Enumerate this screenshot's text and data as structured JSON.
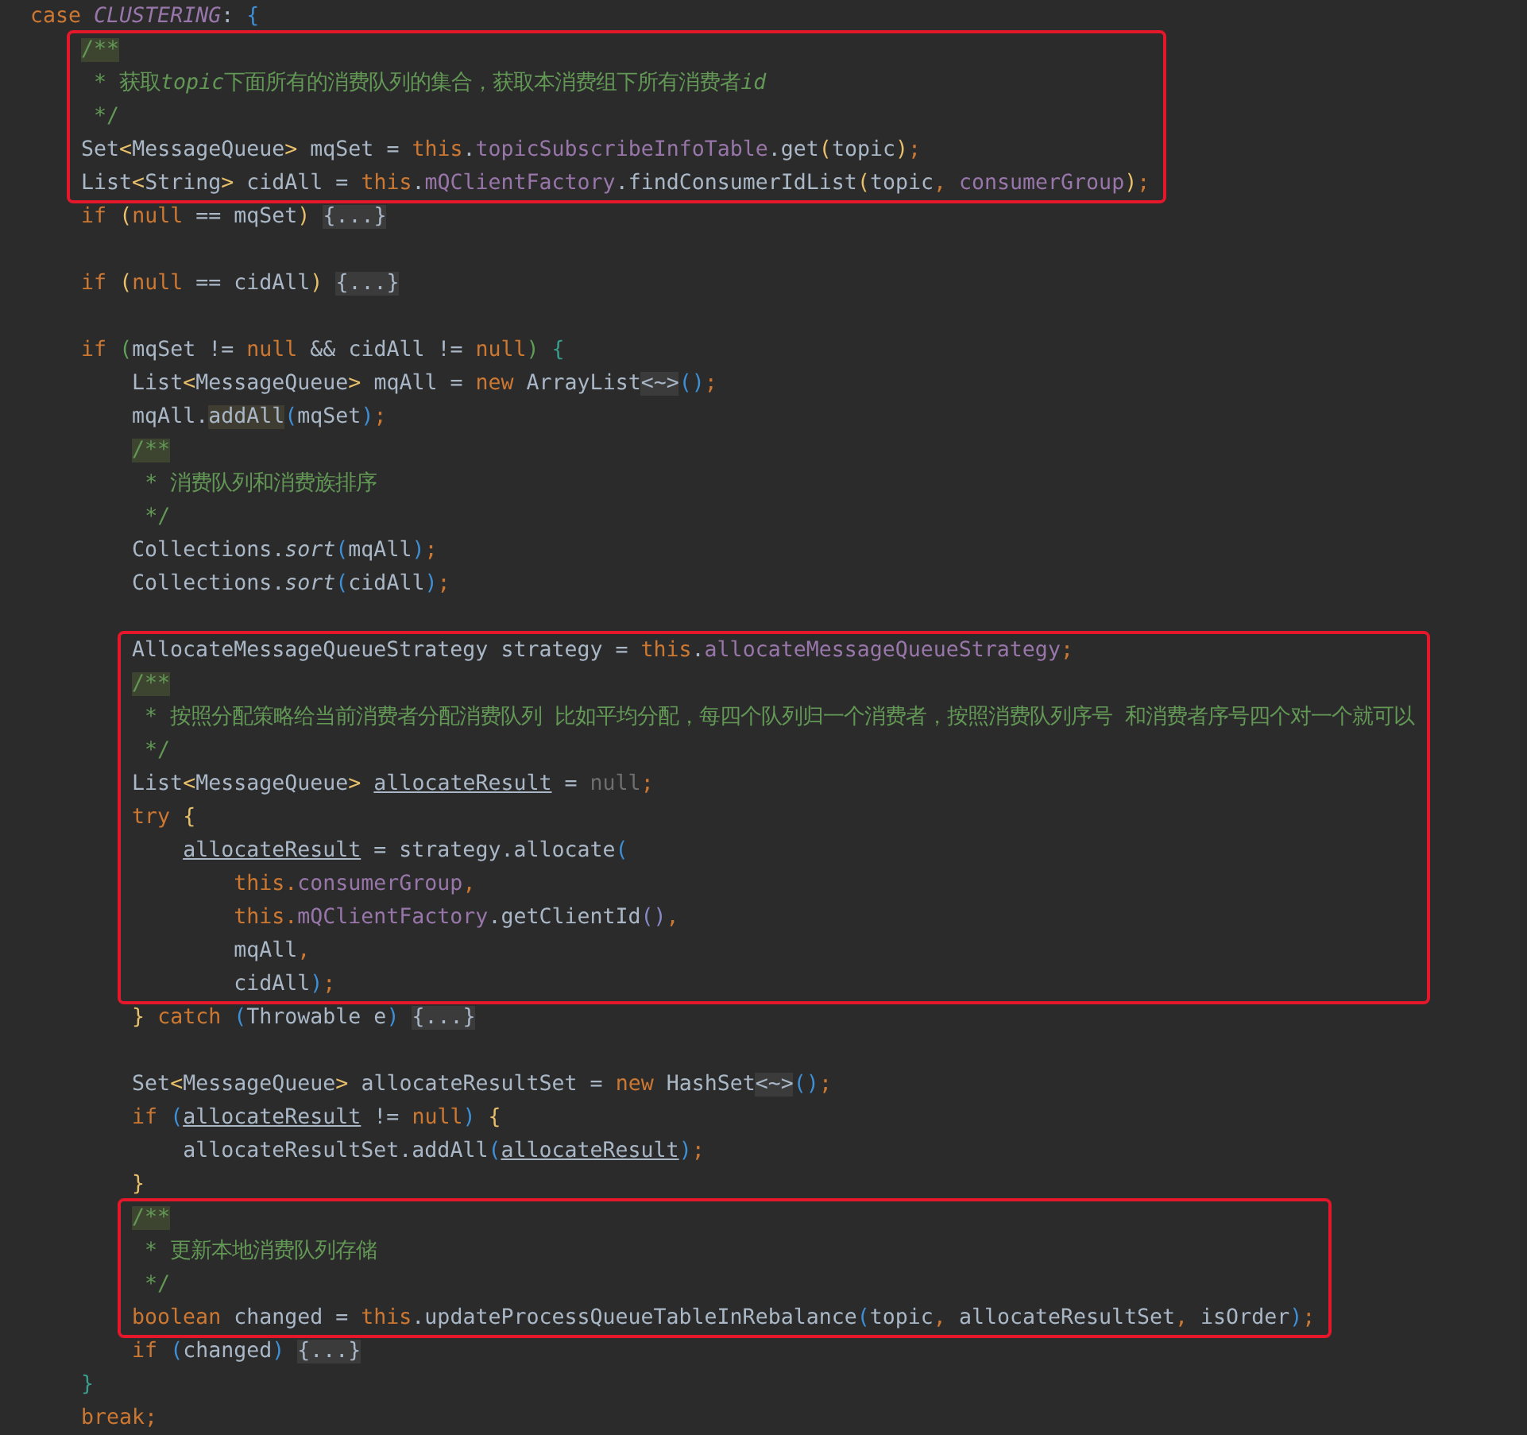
{
  "editor": {
    "segments": [
      {
        "highlighted": false,
        "lines": [
          {
            "kind": "code",
            "tokens": [
              {
                "kind": "keyword",
                "text": "case "
              },
              {
                "kind": "constant",
                "text": "CLUSTERING"
              },
              {
                "kind": "plain",
                "text": ": "
              },
              {
                "kind": "blue",
                "text": "{"
              }
            ]
          }
        ]
      },
      {
        "highlighted": true,
        "lines": [
          {
            "kind": "code",
            "tokens": [
              {
                "kind": "docstart",
                "text": "    /**"
              }
            ]
          },
          {
            "kind": "code",
            "tokens": [
              {
                "kind": "doc",
                "text": "     * 获取"
              },
              {
                "kind": "docitalic",
                "text": "topic"
              },
              {
                "kind": "doc",
                "text": "下面所有的消费队列的集合，获取本消费组下所有消费者"
              },
              {
                "kind": "docitalic",
                "text": "id"
              }
            ]
          },
          {
            "kind": "code",
            "tokens": [
              {
                "kind": "doc",
                "text": "     */"
              }
            ]
          },
          {
            "kind": "code",
            "tokens": [
              {
                "kind": "plain",
                "text": "    Set"
              },
              {
                "kind": "yellow",
                "text": "<"
              },
              {
                "kind": "plain",
                "text": "MessageQueue"
              },
              {
                "kind": "yellow",
                "text": ">"
              },
              {
                "kind": "plain",
                "text": " mqSet = "
              },
              {
                "kind": "keyword",
                "text": "this"
              },
              {
                "kind": "plain",
                "text": "."
              },
              {
                "kind": "field",
                "text": "topicSubscribeInfoTable"
              },
              {
                "kind": "plain",
                "text": ".get"
              },
              {
                "kind": "yellow",
                "text": "("
              },
              {
                "kind": "plain",
                "text": "topic"
              },
              {
                "kind": "yellow",
                "text": ")"
              },
              {
                "kind": "keyword",
                "text": ";"
              }
            ]
          },
          {
            "kind": "code",
            "tokens": [
              {
                "kind": "plain",
                "text": "    List"
              },
              {
                "kind": "yellow",
                "text": "<"
              },
              {
                "kind": "plain",
                "text": "String"
              },
              {
                "kind": "yellow",
                "text": ">"
              },
              {
                "kind": "plain",
                "text": " cidAll = "
              },
              {
                "kind": "keyword",
                "text": "this"
              },
              {
                "kind": "plain",
                "text": "."
              },
              {
                "kind": "field",
                "text": "mQClientFactory"
              },
              {
                "kind": "plain",
                "text": ".findConsumerIdList"
              },
              {
                "kind": "yellow",
                "text": "("
              },
              {
                "kind": "plain",
                "text": "topic"
              },
              {
                "kind": "keyword",
                "text": ", "
              },
              {
                "kind": "field",
                "text": "consumerGroup"
              },
              {
                "kind": "yellow",
                "text": ")"
              },
              {
                "kind": "keyword",
                "text": ";"
              }
            ]
          }
        ]
      },
      {
        "highlighted": false,
        "lines": [
          {
            "kind": "code",
            "tokens": [
              {
                "kind": "keyword",
                "text": "    if "
              },
              {
                "kind": "yellow",
                "text": "("
              },
              {
                "kind": "keyword",
                "text": "null"
              },
              {
                "kind": "plain",
                "text": " == mqSet"
              },
              {
                "kind": "yellow",
                "text": ") "
              },
              {
                "kind": "fold",
                "text": "{...}"
              }
            ]
          },
          {
            "kind": "blank"
          },
          {
            "kind": "code",
            "tokens": [
              {
                "kind": "keyword",
                "text": "    if "
              },
              {
                "kind": "yellow",
                "text": "("
              },
              {
                "kind": "keyword",
                "text": "null"
              },
              {
                "kind": "plain",
                "text": " == cidAll"
              },
              {
                "kind": "yellow",
                "text": ") "
              },
              {
                "kind": "fold",
                "text": "{...}"
              }
            ]
          },
          {
            "kind": "blank"
          },
          {
            "kind": "code",
            "tokens": [
              {
                "kind": "keyword",
                "text": "    if "
              },
              {
                "kind": "green",
                "text": "("
              },
              {
                "kind": "plain",
                "text": "mqSet != "
              },
              {
                "kind": "keyword",
                "text": "null"
              },
              {
                "kind": "plain",
                "text": " && cidAll != "
              },
              {
                "kind": "keyword",
                "text": "null"
              },
              {
                "kind": "green",
                "text": ") "
              },
              {
                "kind": "teal",
                "text": "{"
              }
            ]
          },
          {
            "kind": "code",
            "tokens": [
              {
                "kind": "plain",
                "text": "        List"
              },
              {
                "kind": "yellow",
                "text": "<"
              },
              {
                "kind": "plain",
                "text": "MessageQueue"
              },
              {
                "kind": "yellow",
                "text": ">"
              },
              {
                "kind": "plain",
                "text": " mqAll = "
              },
              {
                "kind": "keyword",
                "text": "new "
              },
              {
                "kind": "plain",
                "text": "ArrayList"
              },
              {
                "kind": "fold",
                "text": "<~>"
              },
              {
                "kind": "blue",
                "text": "()"
              },
              {
                "kind": "keyword",
                "text": ";"
              }
            ]
          },
          {
            "kind": "code",
            "tokens": [
              {
                "kind": "plain",
                "text": "        mqAll."
              },
              {
                "kind": "usage",
                "text": "addAll"
              },
              {
                "kind": "blue",
                "text": "("
              },
              {
                "kind": "plain",
                "text": "mqSet"
              },
              {
                "kind": "blue",
                "text": ")"
              },
              {
                "kind": "keyword",
                "text": ";"
              }
            ]
          },
          {
            "kind": "code",
            "tokens": [
              {
                "kind": "docstart",
                "text": "        /**"
              }
            ]
          },
          {
            "kind": "code",
            "tokens": [
              {
                "kind": "doc",
                "text": "         * 消费队列和消费族排序"
              }
            ]
          },
          {
            "kind": "code",
            "tokens": [
              {
                "kind": "doc",
                "text": "         */"
              }
            ]
          },
          {
            "kind": "code",
            "tokens": [
              {
                "kind": "plain",
                "text": "        Collections."
              },
              {
                "kind": "static",
                "text": "sort"
              },
              {
                "kind": "blue",
                "text": "("
              },
              {
                "kind": "plain",
                "text": "mqAll"
              },
              {
                "kind": "blue",
                "text": ")"
              },
              {
                "kind": "keyword",
                "text": ";"
              }
            ]
          },
          {
            "kind": "code",
            "tokens": [
              {
                "kind": "plain",
                "text": "        Collections."
              },
              {
                "kind": "static",
                "text": "sort"
              },
              {
                "kind": "blue",
                "text": "("
              },
              {
                "kind": "plain",
                "text": "cidAll"
              },
              {
                "kind": "blue",
                "text": ")"
              },
              {
                "kind": "keyword",
                "text": ";"
              }
            ]
          },
          {
            "kind": "blank"
          }
        ]
      },
      {
        "highlighted": true,
        "lines": [
          {
            "kind": "code",
            "tokens": [
              {
                "kind": "plain",
                "text": "        AllocateMessageQueueStrategy strategy = "
              },
              {
                "kind": "keyword",
                "text": "this"
              },
              {
                "kind": "plain",
                "text": "."
              },
              {
                "kind": "field",
                "text": "allocateMessageQueueStrategy"
              },
              {
                "kind": "keyword",
                "text": ";"
              }
            ]
          },
          {
            "kind": "code",
            "tokens": [
              {
                "kind": "docstart",
                "text": "        /**"
              }
            ]
          },
          {
            "kind": "code",
            "tokens": [
              {
                "kind": "doc",
                "text": "         * 按照分配策略给当前消费者分配消费队列 比如平均分配，每四个队列归一个消费者，按照消费队列序号 和消费者序号四个对一个就可以"
              }
            ]
          },
          {
            "kind": "code",
            "tokens": [
              {
                "kind": "doc",
                "text": "         */"
              }
            ]
          },
          {
            "kind": "code",
            "tokens": [
              {
                "kind": "plain",
                "text": "        List"
              },
              {
                "kind": "yellow",
                "text": "<"
              },
              {
                "kind": "plain",
                "text": "MessageQueue"
              },
              {
                "kind": "yellow",
                "text": "> "
              },
              {
                "kind": "underline",
                "text": "allocateResult"
              },
              {
                "kind": "plain",
                "text": " = "
              },
              {
                "kind": "dim",
                "text": "null"
              },
              {
                "kind": "keyword",
                "text": ";"
              }
            ]
          },
          {
            "kind": "code",
            "tokens": [
              {
                "kind": "keyword",
                "text": "        try "
              },
              {
                "kind": "yellow",
                "text": "{"
              }
            ]
          },
          {
            "kind": "code",
            "tokens": [
              {
                "kind": "underline",
                "text": "            allocateResult"
              },
              {
                "kind": "plain",
                "text": " = strategy.allocate"
              },
              {
                "kind": "blue",
                "text": "("
              }
            ]
          },
          {
            "kind": "code",
            "tokens": [
              {
                "kind": "keyword",
                "text": "                this."
              },
              {
                "kind": "field",
                "text": "consumerGroup"
              },
              {
                "kind": "keyword",
                "text": ","
              }
            ]
          },
          {
            "kind": "code",
            "tokens": [
              {
                "kind": "keyword",
                "text": "                this."
              },
              {
                "kind": "field",
                "text": "mQClientFactory"
              },
              {
                "kind": "plain",
                "text": ".getClientId"
              },
              {
                "kind": "violet",
                "text": "()"
              },
              {
                "kind": "keyword",
                "text": ","
              }
            ]
          },
          {
            "kind": "code",
            "tokens": [
              {
                "kind": "plain",
                "text": "                mqAll"
              },
              {
                "kind": "keyword",
                "text": ","
              }
            ]
          },
          {
            "kind": "code",
            "tokens": [
              {
                "kind": "plain",
                "text": "                cidAll"
              },
              {
                "kind": "blue",
                "text": ")"
              },
              {
                "kind": "keyword",
                "text": ";"
              }
            ]
          }
        ]
      },
      {
        "highlighted": false,
        "lines": [
          {
            "kind": "code",
            "tokens": [
              {
                "kind": "yellow",
                "text": "        } "
              },
              {
                "kind": "keyword",
                "text": "catch "
              },
              {
                "kind": "blue",
                "text": "("
              },
              {
                "kind": "plain",
                "text": "Throwable e"
              },
              {
                "kind": "blue",
                "text": ") "
              },
              {
                "kind": "fold",
                "text": "{...}"
              }
            ]
          },
          {
            "kind": "blank"
          },
          {
            "kind": "code",
            "tokens": [
              {
                "kind": "plain",
                "text": "        Set"
              },
              {
                "kind": "yellow",
                "text": "<"
              },
              {
                "kind": "plain",
                "text": "MessageQueue"
              },
              {
                "kind": "yellow",
                "text": ">"
              },
              {
                "kind": "plain",
                "text": " allocateResultSet = "
              },
              {
                "kind": "keyword",
                "text": "new "
              },
              {
                "kind": "plain",
                "text": "HashSet"
              },
              {
                "kind": "fold",
                "text": "<~>"
              },
              {
                "kind": "blue",
                "text": "()"
              },
              {
                "kind": "keyword",
                "text": ";"
              }
            ]
          },
          {
            "kind": "code",
            "tokens": [
              {
                "kind": "keyword",
                "text": "        if "
              },
              {
                "kind": "blue",
                "text": "("
              },
              {
                "kind": "underline",
                "text": "allocateResult"
              },
              {
                "kind": "plain",
                "text": " != "
              },
              {
                "kind": "keyword",
                "text": "null"
              },
              {
                "kind": "blue",
                "text": ") "
              },
              {
                "kind": "yellow",
                "text": "{"
              }
            ]
          },
          {
            "kind": "code",
            "tokens": [
              {
                "kind": "plain",
                "text": "            allocateResultSet.addAll"
              },
              {
                "kind": "blue",
                "text": "("
              },
              {
                "kind": "underline",
                "text": "allocateResult"
              },
              {
                "kind": "blue",
                "text": ")"
              },
              {
                "kind": "keyword",
                "text": ";"
              }
            ]
          },
          {
            "kind": "code",
            "tokens": [
              {
                "kind": "yellow",
                "text": "        }"
              }
            ]
          }
        ]
      },
      {
        "highlighted": true,
        "lines": [
          {
            "kind": "code",
            "tokens": [
              {
                "kind": "docstart",
                "text": "        /**"
              }
            ]
          },
          {
            "kind": "code",
            "tokens": [
              {
                "kind": "doc",
                "text": "         * 更新本地消费队列存储"
              }
            ]
          },
          {
            "kind": "code",
            "tokens": [
              {
                "kind": "doc",
                "text": "         */"
              }
            ]
          },
          {
            "kind": "code",
            "tokens": [
              {
                "kind": "keyword",
                "text": "        boolean "
              },
              {
                "kind": "plain",
                "text": "changed = "
              },
              {
                "kind": "keyword",
                "text": "this"
              },
              {
                "kind": "plain",
                "text": ".updateProcessQueueTableInRebalance"
              },
              {
                "kind": "blue",
                "text": "("
              },
              {
                "kind": "plain",
                "text": "topic"
              },
              {
                "kind": "keyword",
                "text": ", "
              },
              {
                "kind": "plain",
                "text": "allocateResultSet"
              },
              {
                "kind": "keyword",
                "text": ", "
              },
              {
                "kind": "plain",
                "text": "isOrder"
              },
              {
                "kind": "blue",
                "text": ")"
              },
              {
                "kind": "keyword",
                "text": ";"
              }
            ]
          }
        ]
      },
      {
        "highlighted": false,
        "lines": [
          {
            "kind": "code",
            "tokens": [
              {
                "kind": "keyword",
                "text": "        if "
              },
              {
                "kind": "blue",
                "text": "("
              },
              {
                "kind": "plain",
                "text": "changed"
              },
              {
                "kind": "blue",
                "text": ") "
              },
              {
                "kind": "fold",
                "text": "{...}"
              }
            ]
          },
          {
            "kind": "code",
            "tokens": [
              {
                "kind": "teal",
                "text": "    }"
              }
            ]
          },
          {
            "kind": "code",
            "tokens": [
              {
                "kind": "keyword",
                "text": "    break;"
              }
            ]
          }
        ]
      }
    ]
  }
}
